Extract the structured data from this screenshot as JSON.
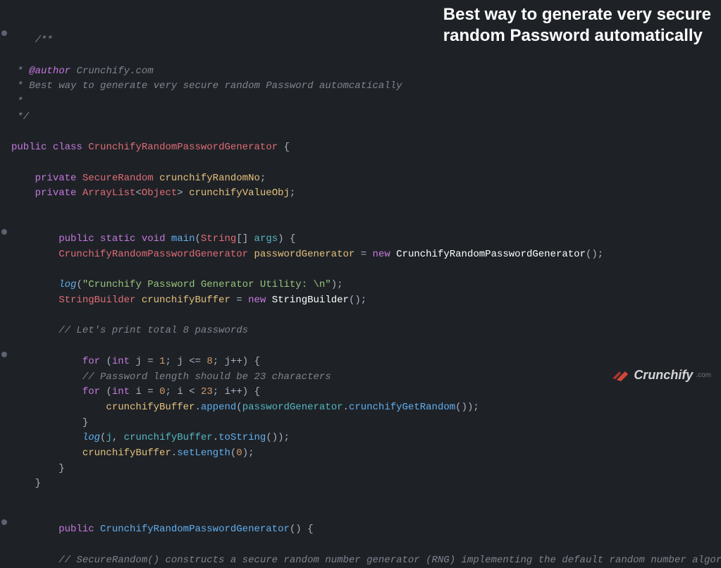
{
  "title_line1": "Best way to generate very secure",
  "title_line2": "random Password automatically",
  "brand": {
    "name": "Crunchify",
    "ext": ".com"
  },
  "doc": {
    "open": "/**",
    "author_tag": "@author",
    "author_value": "Crunchify.com",
    "desc": "Best way to generate very secure random Password automcatically",
    "star": " *",
    "star_pad": " * ",
    "close": " */"
  },
  "k": {
    "public": "public",
    "class": "class",
    "private": "private",
    "static": "static",
    "void": "void",
    "new": "new",
    "for": "for",
    "int": "int"
  },
  "cls": {
    "main": "CrunchifyRandomPasswordGenerator",
    "sr": "SecureRandom",
    "al": "ArrayList",
    "obj": "Object",
    "string": "String",
    "sb": "StringBuilder"
  },
  "fld": {
    "random": "crunchifyRandomNo",
    "valueobj": "crunchifyValueObj"
  },
  "mth": {
    "main": "main",
    "log": "log",
    "append": "append",
    "getrand": "crunchifyGetRandom",
    "tostring": "toString",
    "setlen": "setLength"
  },
  "var": {
    "args": "args",
    "pg": "passwordGenerator",
    "buf": "crunchifyBuffer",
    "j": "j",
    "i": "i"
  },
  "str": {
    "util": "\"Crunchify Password Generator Utility: \\n\""
  },
  "cmt": {
    "eight": "// Let's print total 8 passwords",
    "len23": "// Password length should be 23 characters",
    "secrand": "// SecureRandom() constructs a secure random number generator (RNG) implementing the default random number algorithm."
  },
  "num": {
    "one": "1",
    "eight": "8",
    "zero": "0",
    "three": "23",
    "zero2": "0"
  },
  "sym": {
    "ob": "{",
    "cb": "}",
    "op": "(",
    "cp": ")",
    "sc": ";",
    "lt": "<",
    "gt": ">",
    "eq": " = ",
    "comma": ", ",
    "dot": ".",
    "sqb": "[]",
    "le": " <= ",
    "ltop": " < ",
    "inc": "++",
    "assign": " = "
  }
}
